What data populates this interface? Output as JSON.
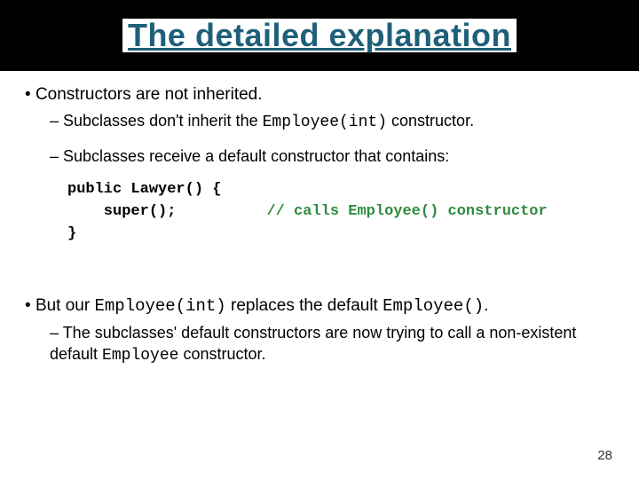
{
  "title": "The detailed explanation",
  "b1": "Constructors are not inherited.",
  "b1a_pre": "Subclasses don't inherit the ",
  "b1a_code": "Employee(int)",
  "b1a_post": " constructor.",
  "b1b": "Subclasses receive a default constructor that contains:",
  "code_line1": "public Lawyer() {",
  "code_line2_indent": "    super();",
  "code_line2_pad": "          ",
  "code_line2_comment": "// calls Employee() constructor",
  "code_line3": "}",
  "b2_pre": "But our ",
  "b2_code1": "Employee(int)",
  "b2_mid": " replaces the default ",
  "b2_code2": "Employee()",
  "b2_post": ".",
  "b2a_pre": "The subclasses' default constructors are now trying to call a non-existent default ",
  "b2a_code": "Employee",
  "b2a_post": " constructor.",
  "pagenum": "28"
}
